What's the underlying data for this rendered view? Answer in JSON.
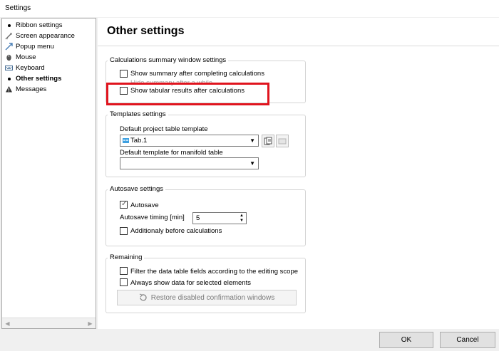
{
  "window": {
    "title": "Settings"
  },
  "sidebar": {
    "items": [
      {
        "label": "Ribbon settings",
        "icon": "bullet"
      },
      {
        "label": "Screen appearance",
        "icon": "screen-appearance-icon"
      },
      {
        "label": "Popup menu",
        "icon": "popup-menu-icon"
      },
      {
        "label": "Mouse",
        "icon": "mouse-icon"
      },
      {
        "label": "Keyboard",
        "icon": "keyboard-icon"
      },
      {
        "label": "Other settings",
        "icon": "bullet",
        "active": true
      },
      {
        "label": "Messages",
        "icon": "messages-icon"
      }
    ]
  },
  "main": {
    "title": "Other settings",
    "calc": {
      "legend": "Calculations summary window settings",
      "show_summary": "Show summary after completing calculations",
      "hide_summary": "Hide summary after a while",
      "show_tabular": "Show tabular results after calculations"
    },
    "templates": {
      "legend": "Templates settings",
      "project_label": "Default project table template",
      "project_value": "Tab.1",
      "manifold_label": "Default template for manifold table",
      "manifold_value": ""
    },
    "autosave": {
      "legend": "Autosave settings",
      "autosave_label": "Autosave",
      "timing_label": "Autosave timing [min]",
      "timing_value": "5",
      "before_calc_label": "Additionaly before calculations"
    },
    "remaining": {
      "legend": "Remaining",
      "filter_label": "Filter the data table fields according to the editing scope",
      "always_show_label": "Always show data for selected elements",
      "restore_label": "Restore disabled confirmation windows"
    }
  },
  "footer": {
    "ok": "OK",
    "cancel": "Cancel"
  },
  "colors": {
    "highlight": "#e0141e",
    "accent": "#1e90ff"
  }
}
